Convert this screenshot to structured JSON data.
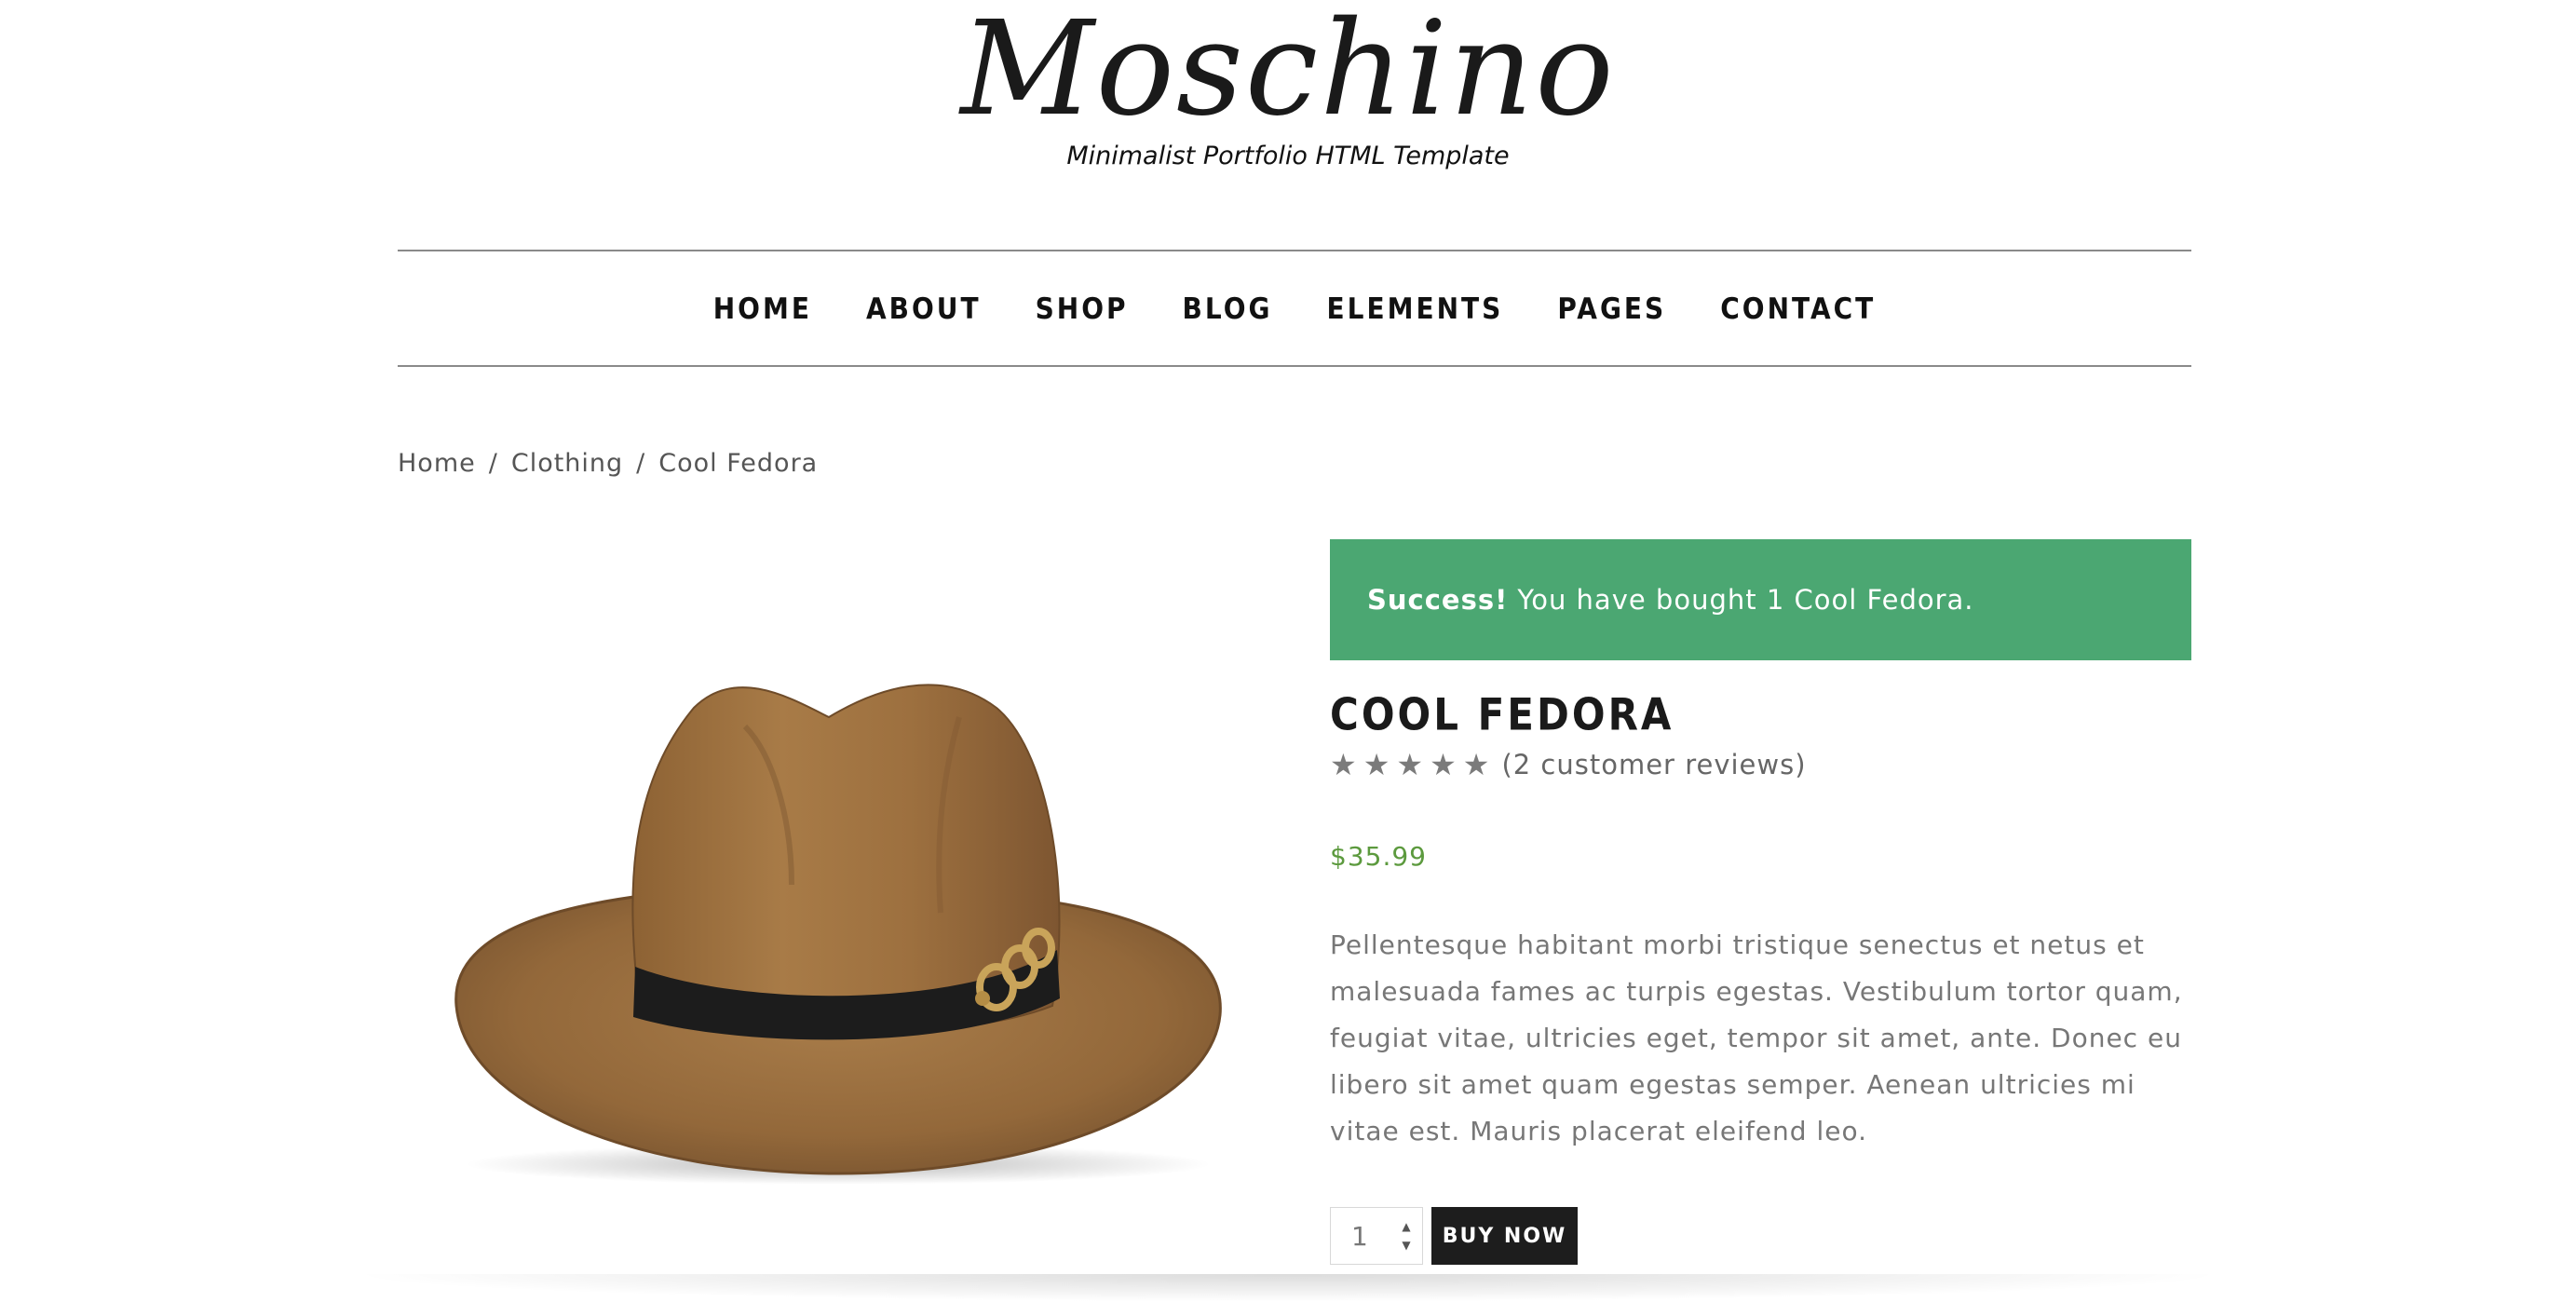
{
  "brand": {
    "logo_text": "Moschino",
    "tagline": "Minimalist Portfolio HTML Template"
  },
  "nav": {
    "items": [
      {
        "label": "HOME"
      },
      {
        "label": "ABOUT"
      },
      {
        "label": "SHOP"
      },
      {
        "label": "BLOG"
      },
      {
        "label": "ELEMENTS"
      },
      {
        "label": "PAGES"
      },
      {
        "label": "CONTACT"
      }
    ]
  },
  "breadcrumb": {
    "items": [
      "Home",
      "Clothing",
      "Cool Fedora"
    ],
    "separator": "/"
  },
  "alert": {
    "strong": "Success!",
    "message": "You have bought 1 Cool Fedora.",
    "color": "#4ba772"
  },
  "product": {
    "title": "COOL FEDORA",
    "rating_stars": 5,
    "reviews_text": "(2 customer reviews)",
    "price": "$35.99",
    "price_color": "#5c9a3e",
    "description": "Pellentesque habitant morbi tristique senectus et netus et malesuada fames ac turpis egestas. Vestibulum tortor quam, feugiat vitae, ultricies eget, tempor sit amet, ante. Donec eu libero sit amet quam egestas semper. Aenean ultricies mi vitae est. Mauris placerat eleifend leo.",
    "image_icon": "fedora-hat-image"
  },
  "purchase": {
    "quantity": "1",
    "buy_label": "BUY NOW"
  },
  "icons": {
    "star": "★",
    "spin_up": "▲",
    "spin_down": "▼"
  }
}
